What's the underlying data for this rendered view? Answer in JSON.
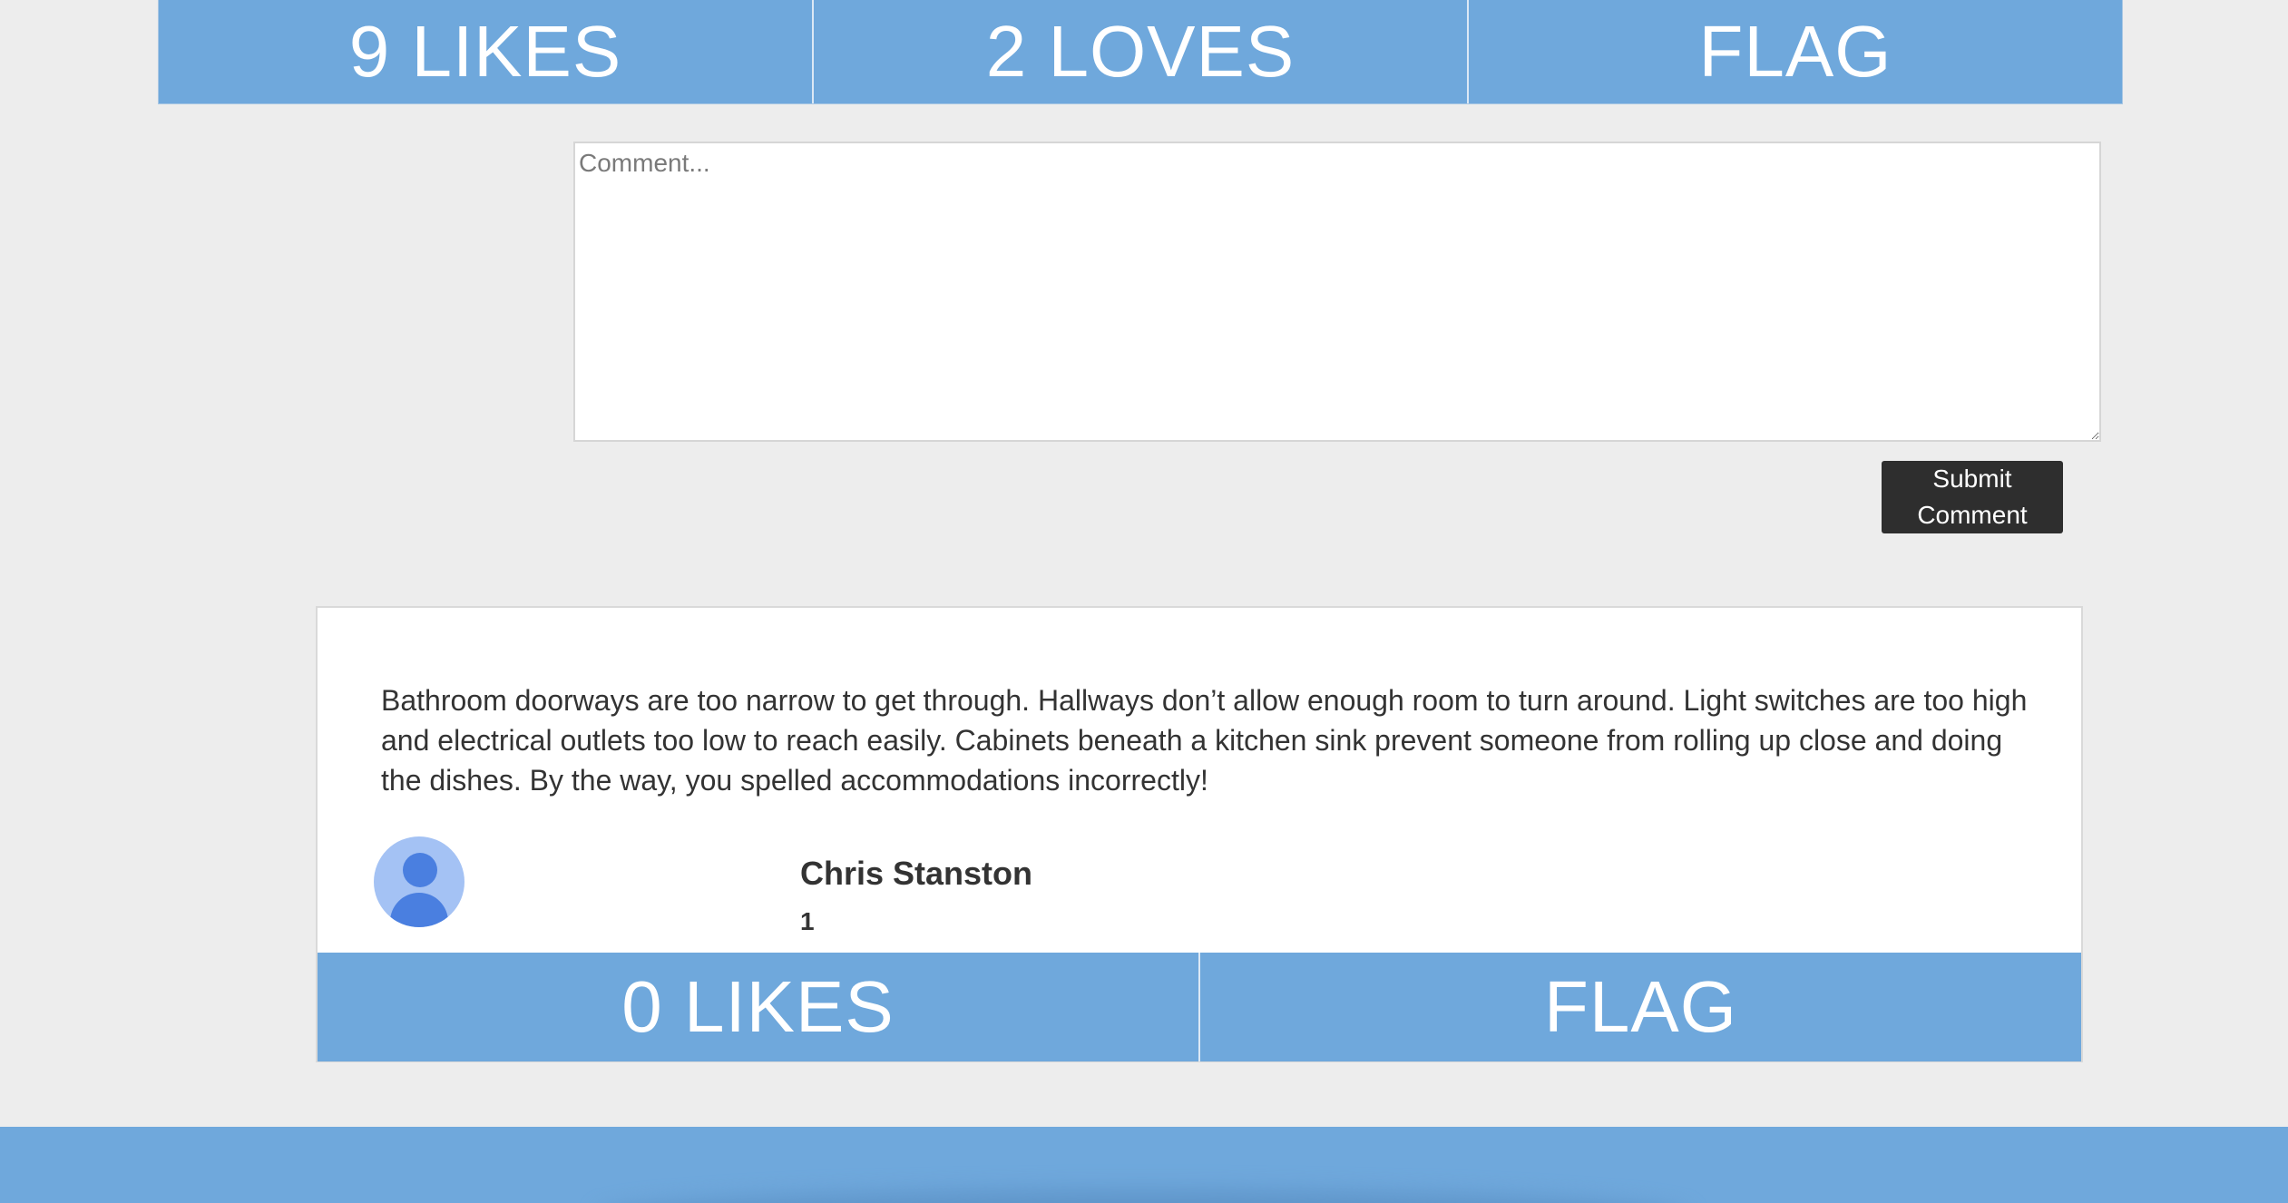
{
  "top_reactions": {
    "likes_label": "9 LIKES",
    "loves_label": "2 LOVES",
    "flag_label": "FLAG"
  },
  "comment_form": {
    "placeholder": "Comment...",
    "value": "",
    "submit_label": "Submit\nComment"
  },
  "comment": {
    "text": "Bathroom doorways are too narrow to get through. Hallways don’t allow enough room to turn around. Light switches are too high and electrical outlets too low to reach easily. Cabinets beneath a kitchen sink prevent someone from rolling up close and doing the dishes. By the way, you spelled accommodations incorrectly!",
    "author": "Chris Stanston",
    "count": "1",
    "likes_label": "0 LIKES",
    "flag_label": "FLAG"
  },
  "colors": {
    "accent": "#6fa8dc",
    "button_dark": "#2e2e2e",
    "avatar_bg": "#a4c2f4",
    "avatar_fg": "#4a7fe0"
  },
  "icons": {
    "avatar": "user-avatar-icon"
  }
}
